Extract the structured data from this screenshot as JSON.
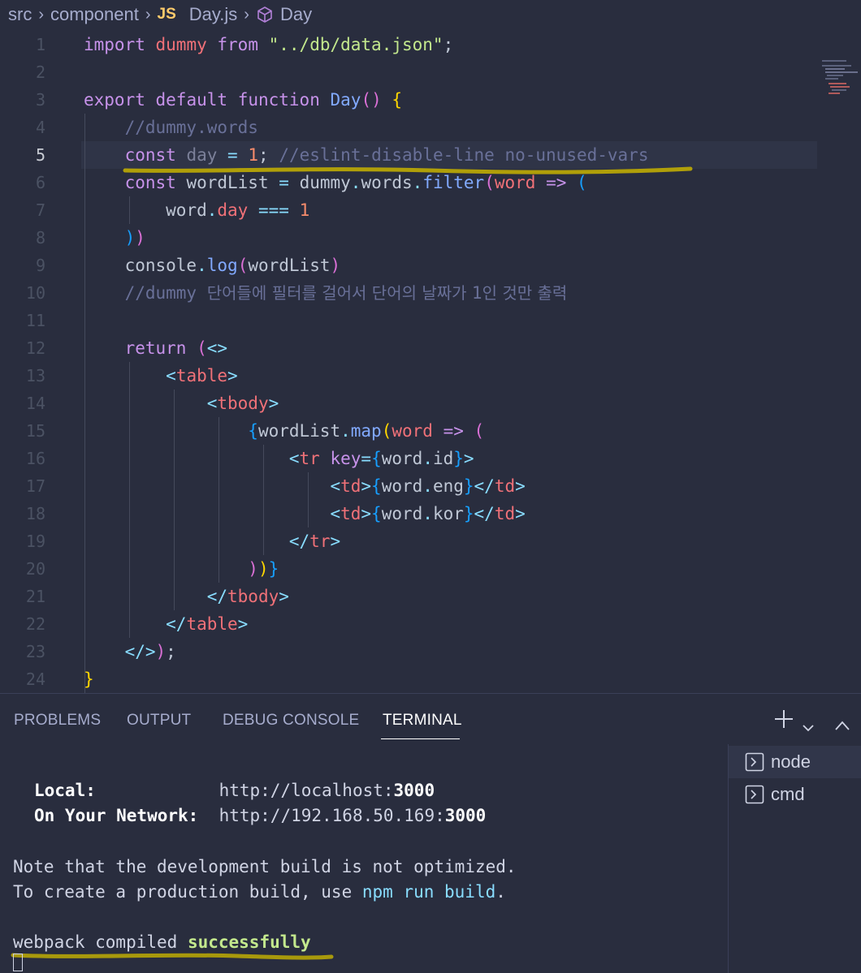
{
  "breadcrumb": {
    "items": [
      "src",
      "component",
      "Day.js",
      "Day"
    ],
    "file_badge": "JS"
  },
  "editor": {
    "active_line": 5,
    "lines": [
      {
        "n": "1"
      },
      {
        "n": "2"
      },
      {
        "n": "3"
      },
      {
        "n": "4"
      },
      {
        "n": "5"
      },
      {
        "n": "6"
      },
      {
        "n": "7"
      },
      {
        "n": "8"
      },
      {
        "n": "9"
      },
      {
        "n": "10"
      },
      {
        "n": "11"
      },
      {
        "n": "12"
      },
      {
        "n": "13"
      },
      {
        "n": "14"
      },
      {
        "n": "15"
      },
      {
        "n": "16"
      },
      {
        "n": "17"
      },
      {
        "n": "18"
      },
      {
        "n": "19"
      },
      {
        "n": "20"
      },
      {
        "n": "21"
      },
      {
        "n": "22"
      },
      {
        "n": "23"
      },
      {
        "n": "24"
      }
    ],
    "code": [
      [
        [
          "kw",
          "import"
        ],
        [
          "pl",
          " "
        ],
        [
          "var",
          "dummy"
        ],
        [
          "pl",
          " "
        ],
        [
          "kw",
          "from"
        ],
        [
          "pl",
          " "
        ],
        [
          "str",
          "\"../db/data.json\""
        ],
        [
          "pl",
          ";"
        ]
      ],
      [],
      [
        [
          "kw",
          "export"
        ],
        [
          "pl",
          " "
        ],
        [
          "kw",
          "default"
        ],
        [
          "pl",
          " "
        ],
        [
          "kw",
          "function"
        ],
        [
          "pl",
          " "
        ],
        [
          "fn",
          "Day"
        ],
        [
          "brk2",
          "()"
        ],
        [
          "pl",
          " "
        ],
        [
          "brk1",
          "{"
        ]
      ],
      [
        [
          "pl",
          "    "
        ],
        [
          "cm",
          "//dummy.words"
        ]
      ],
      [
        [
          "pl",
          "    "
        ],
        [
          "kw",
          "const"
        ],
        [
          "pl",
          " "
        ],
        [
          "dim",
          "day"
        ],
        [
          "pl",
          " "
        ],
        [
          "op",
          "="
        ],
        [
          "pl",
          " "
        ],
        [
          "num",
          "1"
        ],
        [
          "pl",
          "; "
        ],
        [
          "cm",
          "//eslint-disable-line no-unused-vars"
        ]
      ],
      [
        [
          "pl",
          "    "
        ],
        [
          "kw",
          "const"
        ],
        [
          "pl",
          " "
        ],
        [
          "pl",
          "wordList"
        ],
        [
          "pl",
          " "
        ],
        [
          "op",
          "="
        ],
        [
          "pl",
          " "
        ],
        [
          "pl",
          "dummy"
        ],
        [
          "op",
          "."
        ],
        [
          "pl",
          "words"
        ],
        [
          "op",
          "."
        ],
        [
          "fn",
          "filter"
        ],
        [
          "brk2",
          "("
        ],
        [
          "var",
          "word"
        ],
        [
          "pl",
          " "
        ],
        [
          "kw",
          "=>"
        ],
        [
          "pl",
          " "
        ],
        [
          "brk3",
          "("
        ]
      ],
      [
        [
          "pl",
          "        "
        ],
        [
          "pl",
          "word"
        ],
        [
          "op",
          "."
        ],
        [
          "var",
          "day"
        ],
        [
          "pl",
          " "
        ],
        [
          "op",
          "==="
        ],
        [
          "pl",
          " "
        ],
        [
          "num",
          "1"
        ]
      ],
      [
        [
          "pl",
          "    "
        ],
        [
          "brk3",
          ")"
        ],
        [
          "brk2",
          ")"
        ]
      ],
      [
        [
          "pl",
          "    "
        ],
        [
          "pl",
          "console"
        ],
        [
          "op",
          "."
        ],
        [
          "fn",
          "log"
        ],
        [
          "brk2",
          "("
        ],
        [
          "pl",
          "wordList"
        ],
        [
          "brk2",
          ")"
        ]
      ],
      [
        [
          "pl",
          "    "
        ],
        [
          "cm",
          "//dummy "
        ],
        [
          "ko",
          "단어들에 필터를 걸어서 단어의 날짜가 "
        ],
        [
          "cm",
          "1"
        ],
        [
          "ko",
          "인 것만 출력"
        ]
      ],
      [],
      [
        [
          "pl",
          "    "
        ],
        [
          "kw",
          "return"
        ],
        [
          "pl",
          " "
        ],
        [
          "brk2",
          "("
        ],
        [
          "op",
          "<>"
        ]
      ],
      [
        [
          "pl",
          "        "
        ],
        [
          "op",
          "<"
        ],
        [
          "tag",
          "table"
        ],
        [
          "op",
          ">"
        ]
      ],
      [
        [
          "pl",
          "            "
        ],
        [
          "op",
          "<"
        ],
        [
          "tag",
          "tbody"
        ],
        [
          "op",
          ">"
        ]
      ],
      [
        [
          "pl",
          "                "
        ],
        [
          "brk3",
          "{"
        ],
        [
          "pl",
          "wordList"
        ],
        [
          "op",
          "."
        ],
        [
          "fn",
          "map"
        ],
        [
          "brk1",
          "("
        ],
        [
          "var",
          "word"
        ],
        [
          "pl",
          " "
        ],
        [
          "kw",
          "=>"
        ],
        [
          "pl",
          " "
        ],
        [
          "brk2",
          "("
        ]
      ],
      [
        [
          "pl",
          "                    "
        ],
        [
          "op",
          "<"
        ],
        [
          "tag",
          "tr"
        ],
        [
          "pl",
          " "
        ],
        [
          "kw",
          "key"
        ],
        [
          "op",
          "="
        ],
        [
          "brk3",
          "{"
        ],
        [
          "pl",
          "word"
        ],
        [
          "op",
          "."
        ],
        [
          "pl",
          "id"
        ],
        [
          "brk3",
          "}"
        ],
        [
          "op",
          ">"
        ]
      ],
      [
        [
          "pl",
          "                        "
        ],
        [
          "op",
          "<"
        ],
        [
          "tag",
          "td"
        ],
        [
          "op",
          ">"
        ],
        [
          "brk3",
          "{"
        ],
        [
          "pl",
          "word"
        ],
        [
          "op",
          "."
        ],
        [
          "pl",
          "eng"
        ],
        [
          "brk3",
          "}"
        ],
        [
          "op",
          "</"
        ],
        [
          "tag",
          "td"
        ],
        [
          "op",
          ">"
        ]
      ],
      [
        [
          "pl",
          "                        "
        ],
        [
          "op",
          "<"
        ],
        [
          "tag",
          "td"
        ],
        [
          "op",
          ">"
        ],
        [
          "brk3",
          "{"
        ],
        [
          "pl",
          "word"
        ],
        [
          "op",
          "."
        ],
        [
          "pl",
          "kor"
        ],
        [
          "brk3",
          "}"
        ],
        [
          "op",
          "</"
        ],
        [
          "tag",
          "td"
        ],
        [
          "op",
          ">"
        ]
      ],
      [
        [
          "pl",
          "                    "
        ],
        [
          "op",
          "</"
        ],
        [
          "tag",
          "tr"
        ],
        [
          "op",
          ">"
        ]
      ],
      [
        [
          "pl",
          "                "
        ],
        [
          "brk2",
          ")"
        ],
        [
          "brk1",
          ")"
        ],
        [
          "brk3",
          "}"
        ]
      ],
      [
        [
          "pl",
          "            "
        ],
        [
          "op",
          "</"
        ],
        [
          "tag",
          "tbody"
        ],
        [
          "op",
          ">"
        ]
      ],
      [
        [
          "pl",
          "        "
        ],
        [
          "op",
          "</"
        ],
        [
          "tag",
          "table"
        ],
        [
          "op",
          ">"
        ]
      ],
      [
        [
          "pl",
          "    "
        ],
        [
          "op",
          "</>"
        ],
        [
          "brk2",
          ")"
        ],
        [
          "pl",
          ";"
        ]
      ],
      [
        [
          "brk1",
          "}"
        ]
      ]
    ]
  },
  "panel": {
    "tabs": [
      "PROBLEMS",
      "OUTPUT",
      "DEBUG CONSOLE",
      "TERMINAL"
    ],
    "active_tab": "TERMINAL",
    "terminals": [
      {
        "label": "node",
        "active": true
      },
      {
        "label": "cmd",
        "active": false
      }
    ]
  },
  "terminal": {
    "local_label": "Local:",
    "local_url_prefix": "http://localhost:",
    "local_port": "3000",
    "network_label": "On Your Network:",
    "network_url_prefix": "http://192.168.50.169:",
    "network_port": "3000",
    "note_line": "Note that the development build is not optimized.",
    "create_prefix": "To create a production build, use ",
    "create_cmd": "npm run build",
    "create_suffix": ".",
    "compiled_prefix": "webpack compiled ",
    "compiled_status": "successfully"
  },
  "colors": {
    "background": "#292d3e",
    "keyword": "#c792ea",
    "function": "#82aaff",
    "string": "#c3e88d",
    "comment": "#697098",
    "highlight_underline": "#c8b400"
  }
}
